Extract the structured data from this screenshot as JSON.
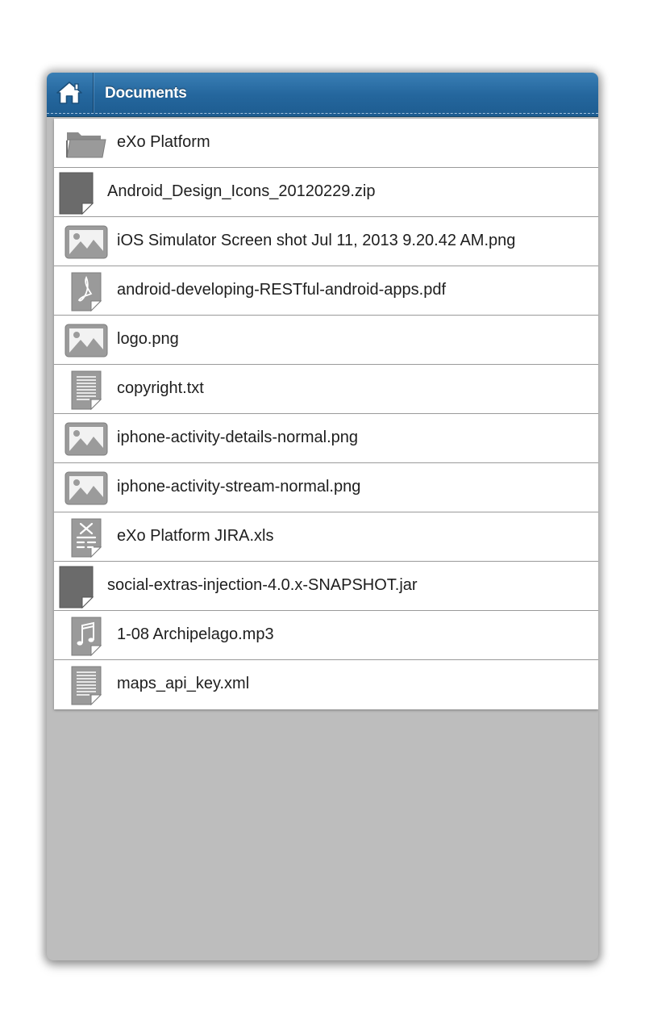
{
  "header": {
    "title": "Documents",
    "home_icon": "home-icon",
    "accent": "#25679e"
  },
  "files": [
    {
      "name": "eXo Platform",
      "icon": "folder-icon"
    },
    {
      "name": "Android_Design_Icons_20120229.zip",
      "icon": "file-icon"
    },
    {
      "name": "iOS Simulator Screen shot Jul 11, 2013 9.20.42 AM.png",
      "icon": "image-icon"
    },
    {
      "name": "android-developing-RESTful-android-apps.pdf",
      "icon": "pdf-icon"
    },
    {
      "name": "logo.png",
      "icon": "image-icon"
    },
    {
      "name": "copyright.txt",
      "icon": "text-file-icon"
    },
    {
      "name": "iphone-activity-details-normal.png",
      "icon": "image-icon"
    },
    {
      "name": "iphone-activity-stream-normal.png",
      "icon": "image-icon"
    },
    {
      "name": "eXo Platform JIRA.xls",
      "icon": "spreadsheet-icon"
    },
    {
      "name": "social-extras-injection-4.0.x-SNAPSHOT.jar",
      "icon": "file-icon"
    },
    {
      "name": "1-08 Archipelago.mp3",
      "icon": "music-icon"
    },
    {
      "name": "maps_api_key.xml",
      "icon": "text-file-icon"
    }
  ]
}
